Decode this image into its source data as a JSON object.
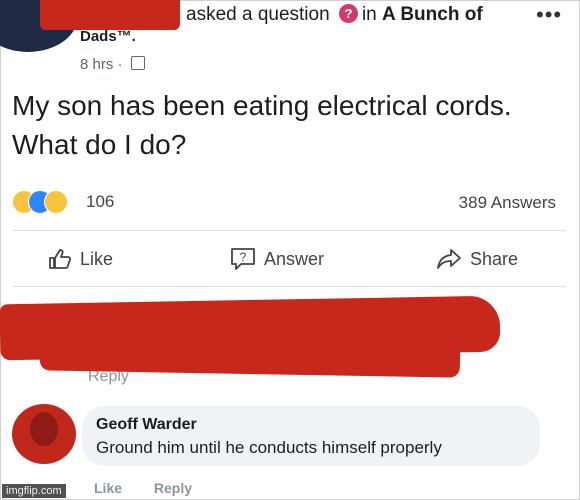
{
  "post": {
    "header_prefix": "asked a question",
    "header_in": "in",
    "group_name": "A Bunch of",
    "group_name_cont": "Dads™.",
    "more_label": "•••",
    "time": "8 hrs ·",
    "question_text": "My son has been eating electrical cords. What do I do?",
    "reaction_count": "106",
    "answers_count": "389 Answers"
  },
  "actions": {
    "like": "Like",
    "answer": "Answer",
    "share": "Share"
  },
  "comments": {
    "prior_reply": "Reply",
    "name": "Geoff Warder",
    "text": "Ground him until he conducts himself properly",
    "like": "Like",
    "reply": "Reply"
  },
  "watermark": "imgflip.com",
  "colors": {
    "redaction": "#c8281b",
    "question_badge": "#d6376b",
    "like_reaction": "#2d86ff",
    "comment_bubble": "#f0f2f5"
  }
}
